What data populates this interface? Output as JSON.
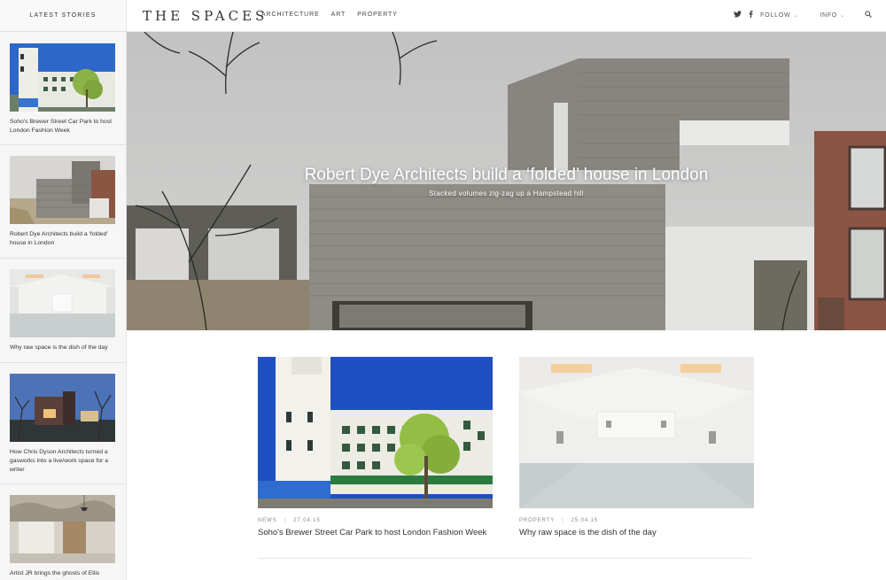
{
  "sidebar": {
    "header": "LATEST STORIES",
    "stories": [
      {
        "caption": "Soho's Brewer Street Car Park to host London Fashion Week"
      },
      {
        "caption": "Robert Dye Architects build a 'folded' house in London"
      },
      {
        "caption": "Why raw space is the dish of the day"
      },
      {
        "caption": "How Chris Dyson Architects turned a gasworks into a live/work space for a writer"
      },
      {
        "caption": "Artist JR brings the ghosts of Ellis"
      }
    ]
  },
  "header": {
    "logo": "THE SPACES",
    "nav": [
      "ARCHITECTURE",
      "ART",
      "PROPERTY"
    ],
    "follow_label": "FOLLOW",
    "info_label": "INFO"
  },
  "hero": {
    "title": "Robert Dye Architects build a ‘folded’ house in London",
    "subtitle": "Stacked volumes zig-zag up a Hampstead hill"
  },
  "cards": [
    {
      "category": "NEWS",
      "date": "27.04.15",
      "title": "Soho's Brewer Street Car Park to host London Fashion Week"
    },
    {
      "category": "PROPERTY",
      "date": "25.04.15",
      "title": "Why raw space is the dish of the day"
    }
  ],
  "icons": {
    "twitter": "twitter-icon",
    "facebook": "facebook-icon",
    "search": "search-icon",
    "chevron": "chevron-down-icon"
  }
}
